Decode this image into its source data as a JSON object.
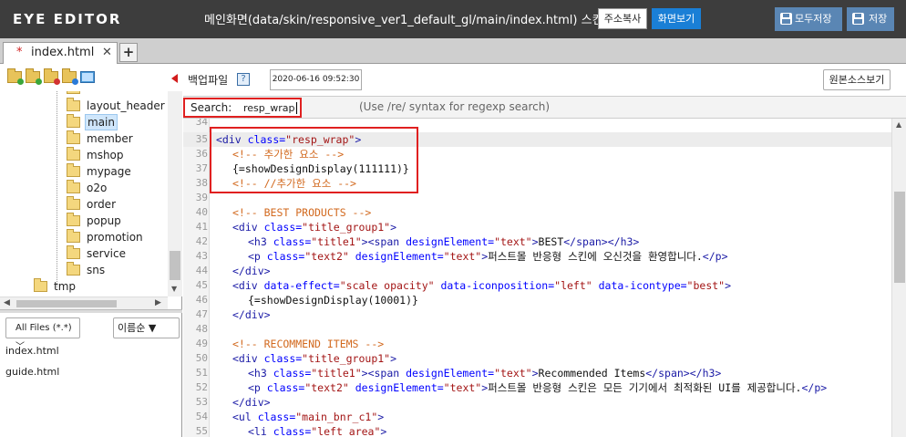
{
  "app": {
    "brand": "EYE EDITOR",
    "title": "메인화면(data/skin/responsive_ver1_default_gl/main/index.html) 스킨",
    "copy_address": "주소복사",
    "view_screen": "화면보기",
    "save_all": "모두저장",
    "save": "저장"
  },
  "tabs": [
    {
      "modified": "*",
      "label": "index.html",
      "close": "✕"
    }
  ],
  "add_tab": "+",
  "tree": {
    "items": [
      "layout_header",
      "main",
      "member",
      "mshop",
      "mypage",
      "o2o",
      "order",
      "popup",
      "promotion",
      "service",
      "sns",
      "tmp"
    ],
    "selected": "main"
  },
  "filters": {
    "file_filter": "All Files (*.*)",
    "sort": "이름순 ▼"
  },
  "files": [
    "index.html",
    "guide.html"
  ],
  "editor": {
    "backup_label": "백업파일",
    "help": "?",
    "backup_date": "2020-06-16 09:52:30",
    "view_source": "원본소스보기",
    "search_label": "Search:",
    "search_value": "resp_wrap",
    "search_hint": "(Use /re/ syntax for regexp search)"
  },
  "code_lines": [
    {
      "n": "34"
    },
    {
      "n": "35"
    },
    {
      "n": "36"
    },
    {
      "n": "37"
    },
    {
      "n": "38"
    },
    {
      "n": "39"
    },
    {
      "n": "40"
    },
    {
      "n": "41"
    },
    {
      "n": "42"
    },
    {
      "n": "43"
    },
    {
      "n": "44"
    },
    {
      "n": "45"
    },
    {
      "n": "46"
    },
    {
      "n": "47"
    },
    {
      "n": "48"
    },
    {
      "n": "49"
    },
    {
      "n": "50"
    },
    {
      "n": "51"
    },
    {
      "n": "52"
    },
    {
      "n": "53"
    },
    {
      "n": "54"
    },
    {
      "n": "55"
    }
  ],
  "code_tokens": {
    "div_open": "<div ",
    "class_attr": "class=",
    "resp_wrap": "\"resp_wrap\"",
    "gt": ">",
    "c_add": "<!-- 추가한 요소 -->",
    "show1": "{=showDesignDisplay(111111)}",
    "c_add_end": "<!-- //추가한 요소 -->",
    "c_best": "<!-- BEST PRODUCTS -->",
    "title_group1": "\"title_group1\"",
    "h3_open": "<h3 ",
    "title1": "\"title1\"",
    "span_open": "<span ",
    "design_attr": "designElement=",
    "text_val": "\"text\"",
    "best": "BEST",
    "span_close": "</span>",
    "h3_close": "</h3>",
    "p_open": "<p ",
    "text2": "\"text2\"",
    "welcome": "퍼스트몰 반응형 스킨에 오신것을 환영합니다.",
    "p_close": "</p>",
    "div_close": "</div>",
    "effect_attr": "data-effect=",
    "effect_val": "\"scale opacity\"",
    "iconpos_attr": " data-iconposition=",
    "left_val": "\"left\"",
    "icontype_attr": " data-icontype=",
    "best_val": "\"best\"",
    "show2": "{=showDesignDisplay(10001)}",
    "c_rec": "<!-- RECOMMEND ITEMS -->",
    "recommended": "Recommended Items",
    "opt": "퍼스트몰 반응형 스킨은 모든 기기에서 최적화된 UI를 제공합니다.",
    "ul_open": "<ul ",
    "main_bnr": "\"main_bnr_c1\"",
    "li_open": "<li ",
    "left_area": "\"left_area\""
  }
}
